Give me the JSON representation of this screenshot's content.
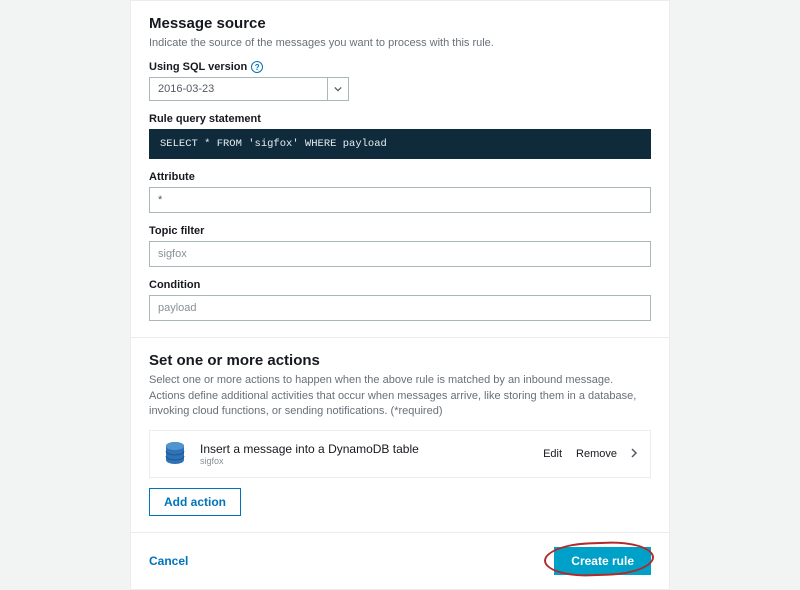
{
  "messageSource": {
    "heading": "Message source",
    "description": "Indicate the source of the messages you want to process with this rule.",
    "sqlVersion": {
      "label": "Using SQL version",
      "value": "2016-03-23"
    },
    "queryStatement": {
      "label": "Rule query statement",
      "code": "SELECT * FROM 'sigfox' WHERE payload"
    },
    "attribute": {
      "label": "Attribute",
      "value": "*"
    },
    "topicFilter": {
      "label": "Topic filter",
      "value": "sigfox"
    },
    "condition": {
      "label": "Condition",
      "value": "payload"
    }
  },
  "actions": {
    "heading": "Set one or more actions",
    "description": "Select one or more actions to happen when the above rule is matched by an inbound message. Actions define additional activities that occur when messages arrive, like storing them in a database, invoking cloud functions, or sending notifications. (*required)",
    "item": {
      "title": "Insert a message into a DynamoDB table",
      "sub": "sigfox",
      "edit": "Edit",
      "remove": "Remove"
    },
    "addAction": "Add action"
  },
  "footer": {
    "cancel": "Cancel",
    "create": "Create rule"
  }
}
